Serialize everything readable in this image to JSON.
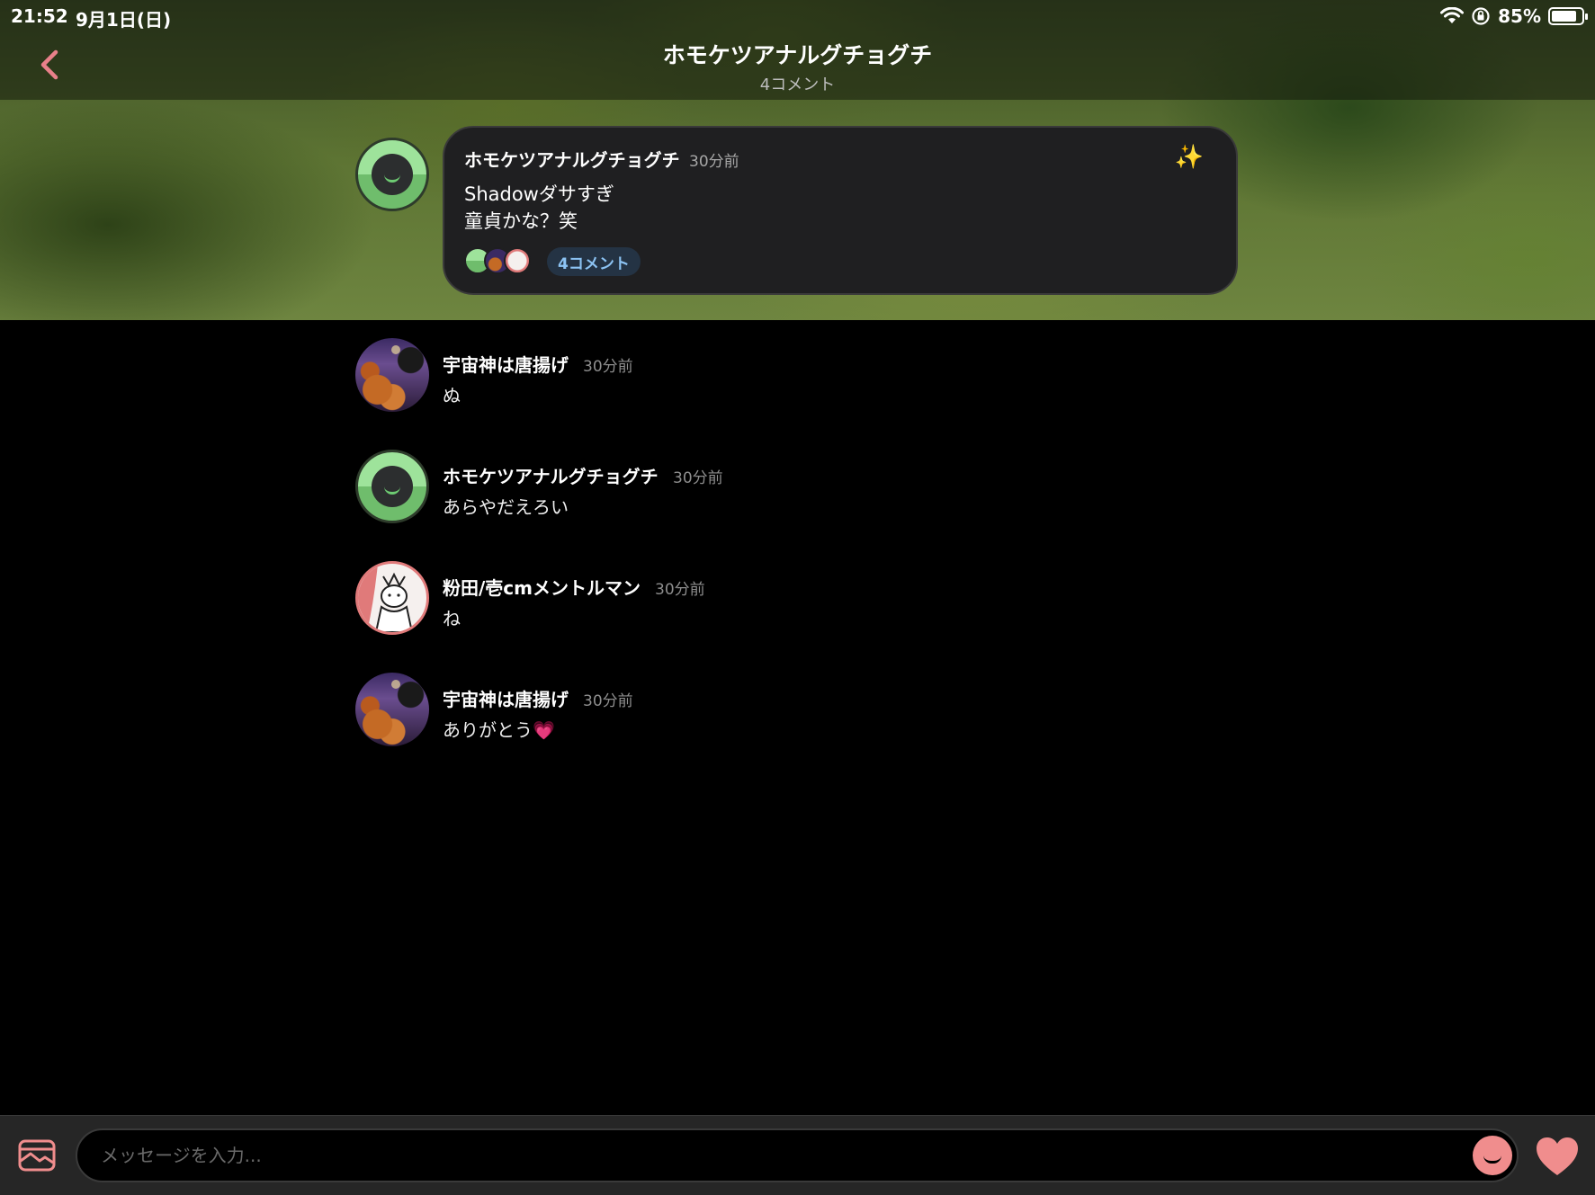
{
  "status": {
    "time": "21:52",
    "date": "9月1日(日)",
    "battery": "85%",
    "battery_level": 0.85
  },
  "nav": {
    "title": "ホモケツアナルグチョグチ",
    "subtitle": "4コメント"
  },
  "post": {
    "author": "ホモケツアナルグチョグチ",
    "time": "30分前",
    "line1": "Shadowダサすぎ",
    "line2": "童貞かな？笑",
    "comment_count": "4コメント",
    "reaction_icon": "sparkles-icon"
  },
  "comments": [
    {
      "author": "宇宙神は唐揚げ",
      "time": "30分前",
      "text": "ぬ",
      "avatar": "food"
    },
    {
      "author": "ホモケツアナルグチョグチ",
      "time": "30分前",
      "text": "あらやだえろい",
      "avatar": "green"
    },
    {
      "author": "粉田/壱cmメントルマン",
      "time": "30分前",
      "text": "ね",
      "avatar": "sketch"
    },
    {
      "author": "宇宙神は唐揚げ",
      "time": "30分前",
      "text": "ありがとう💗",
      "avatar": "food"
    }
  ],
  "composer": {
    "placeholder": "メッセージを入力..."
  },
  "colors": {
    "accent": "#f08d8d",
    "pill_text": "#8cc3f3",
    "card_bg": "#1f1f21"
  }
}
